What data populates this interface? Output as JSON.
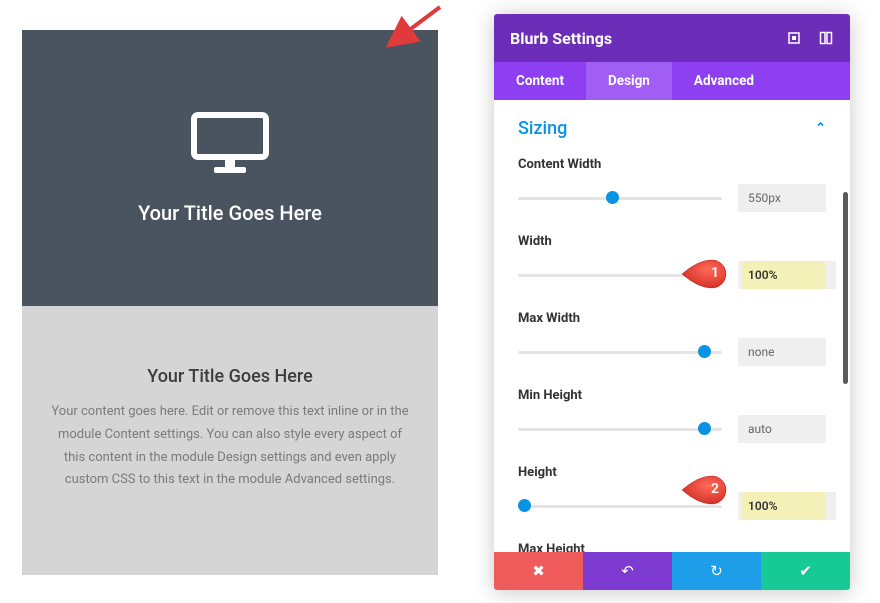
{
  "preview": {
    "top_title": "Your Title Goes Here",
    "bottom_title": "Your Title Goes Here",
    "body_text": "Your content goes here. Edit or remove this text inline or in the module Content settings. You can also style every aspect of this content in the module Design settings and even apply custom CSS to this text in the module Advanced settings."
  },
  "panel": {
    "title": "Blurb Settings",
    "tabs": {
      "content": "Content",
      "design": "Design",
      "advanced": "Advanced"
    },
    "section": "Sizing",
    "options": {
      "content_width": {
        "label": "Content Width",
        "value": "550px",
        "thumb_pct": 43
      },
      "width": {
        "label": "Width",
        "value": "100%",
        "thumb_pct": 100
      },
      "max_width": {
        "label": "Max Width",
        "value": "none",
        "thumb_pct": 90
      },
      "min_height": {
        "label": "Min Height",
        "value": "auto",
        "thumb_pct": 90
      },
      "height": {
        "label": "Height",
        "value": "100%",
        "thumb_pct": 4
      },
      "max_height": {
        "label": "Max Height"
      }
    }
  },
  "callouts": {
    "one": "1",
    "two": "2"
  }
}
